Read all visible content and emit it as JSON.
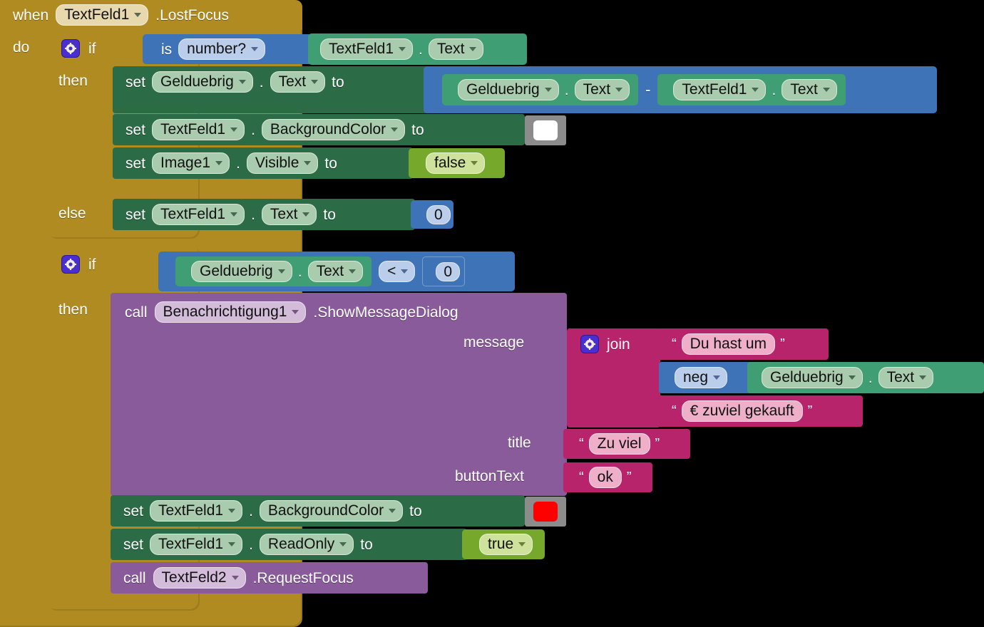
{
  "editor": {
    "name": "MIT App Inventor Blocks Editor",
    "canvas_background": "#000000"
  },
  "palette": {
    "event_gold": "#b08b22",
    "control_gold": "#b08b22",
    "setter_green": "#2b6b45",
    "getter_green": "#3f9e73",
    "math_blue": "#3f73b8",
    "logic_olive": "#76a82c",
    "text_crimson": "#b8246b",
    "procedure_purple": "#8a5b9b",
    "color_gray": "#8c8c8c",
    "mutator_gear": "#4a2fd0"
  },
  "event_block": {
    "when_label": "when",
    "component": "TextFeld1",
    "event": ".LostFocus",
    "do_label": "do"
  },
  "if_block_1": {
    "gear_icon": "gear-icon",
    "if_label": "if",
    "then_label": "then",
    "else_label": "else",
    "condition": {
      "is_label": "is",
      "test": "number?",
      "operand": {
        "component": "TextFeld1",
        "dot": ".",
        "property": "Text"
      }
    },
    "then_statements": [
      {
        "set_label": "set",
        "component": "Gelduebrig",
        "dot": ".",
        "property": "Text",
        "to_label": "to",
        "value_kind": "subtraction",
        "value": {
          "operator": "-",
          "left": {
            "component": "Gelduebrig",
            "dot": ".",
            "property": "Text"
          },
          "right": {
            "component": "TextFeld1",
            "dot": ".",
            "property": "Text"
          }
        }
      },
      {
        "set_label": "set",
        "component": "TextFeld1",
        "dot": ".",
        "property": "BackgroundColor",
        "to_label": "to",
        "value_kind": "color",
        "value": {
          "swatch": "#ffffff"
        }
      },
      {
        "set_label": "set",
        "component": "Image1",
        "dot": ".",
        "property": "Visible",
        "to_label": "to",
        "value_kind": "boolean",
        "value": {
          "literal": "false"
        }
      }
    ],
    "else_statements": [
      {
        "set_label": "set",
        "component": "TextFeld1",
        "dot": ".",
        "property": "Text",
        "to_label": "to",
        "value_kind": "number",
        "value": {
          "literal": "0"
        }
      }
    ]
  },
  "if_block_2": {
    "gear_icon": "gear-icon",
    "if_label": "if",
    "then_label": "then",
    "condition": {
      "left": {
        "component": "Gelduebrig",
        "dot": ".",
        "property": "Text"
      },
      "operator": "<",
      "right": {
        "literal": "0"
      }
    },
    "then_statements": [
      {
        "kind": "call",
        "call_label": "call",
        "component": "Benachrichtigung1",
        "method": ".ShowMessageDialog",
        "args": [
          {
            "name": "message",
            "kind": "join",
            "join_label": "join",
            "gear_icon": "gear-icon",
            "items": [
              {
                "kind": "text",
                "value": "Du hast um"
              },
              {
                "kind": "neg",
                "operator": "neg",
                "operand": {
                  "component": "Gelduebrig",
                  "dot": ".",
                  "property": "Text"
                }
              },
              {
                "kind": "text",
                "value": "€ zuviel gekauft"
              }
            ]
          },
          {
            "name": "title",
            "kind": "text",
            "value": "Zu viel"
          },
          {
            "name": "buttonText",
            "kind": "text",
            "value": "ok"
          }
        ]
      },
      {
        "kind": "set",
        "set_label": "set",
        "component": "TextFeld1",
        "dot": ".",
        "property": "BackgroundColor",
        "to_label": "to",
        "value_kind": "color",
        "value": {
          "swatch": "#ff0000"
        }
      },
      {
        "kind": "set",
        "set_label": "set",
        "component": "TextFeld1",
        "dot": ".",
        "property": "ReadOnly",
        "to_label": "to",
        "value_kind": "boolean",
        "value": {
          "literal": "true"
        }
      },
      {
        "kind": "call",
        "call_label": "call",
        "component": "TextFeld2",
        "method": ".RequestFocus",
        "args": []
      }
    ]
  },
  "quotes": {
    "open": "“",
    "close": "”"
  }
}
